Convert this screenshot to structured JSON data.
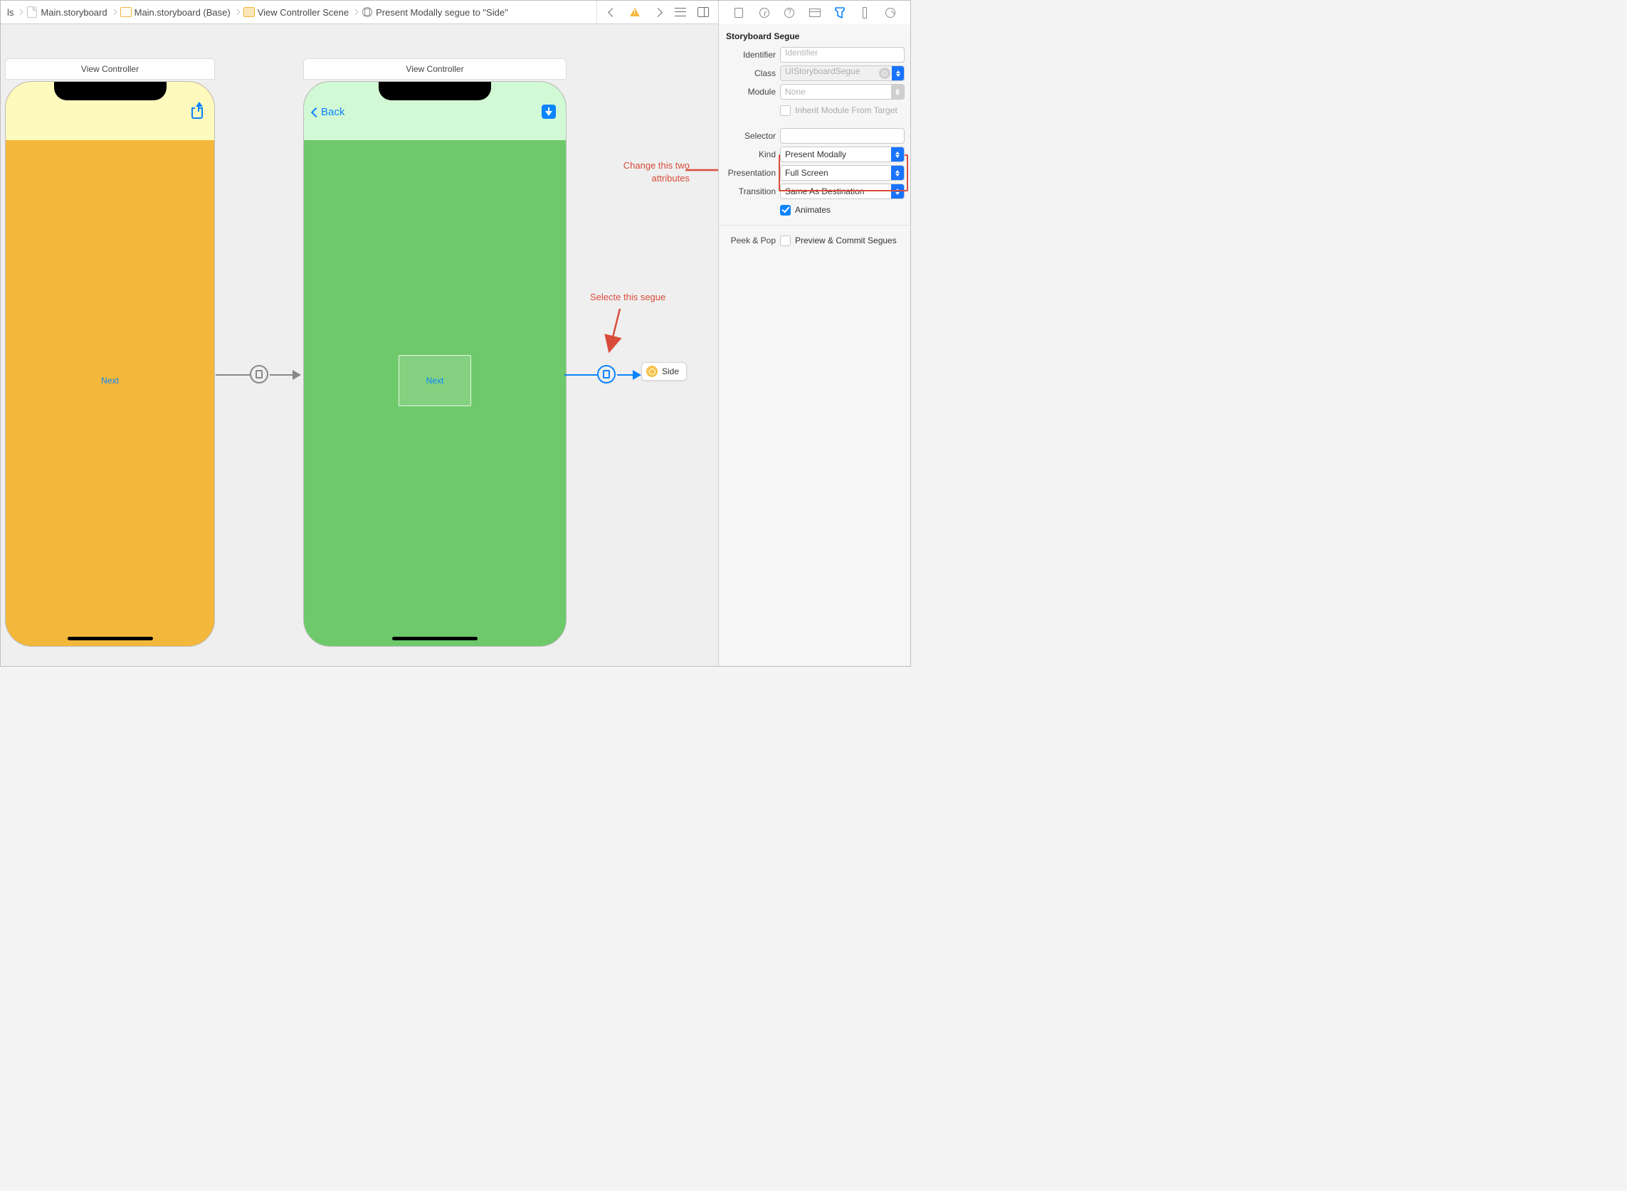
{
  "breadcrumb": {
    "items": [
      {
        "icon": "storyboard-file-icon",
        "label": "Main.storyboard"
      },
      {
        "icon": "storyboard-group-icon",
        "label": "Main.storyboard (Base)"
      },
      {
        "icon": "scene-icon",
        "label": "View Controller Scene"
      },
      {
        "icon": "segue-icon",
        "label": "Present Modally segue to \"Side\""
      }
    ],
    "truncated_prefix": "ls"
  },
  "canvas": {
    "vc1": {
      "title": "View Controller",
      "header_bg": "#fefabe",
      "body_bg": "#f3b73b",
      "nav_right_icon": "share-icon",
      "center_label": "Next"
    },
    "vc2": {
      "title": "View Controller",
      "header_bg": "#d2f9d5",
      "body_bg": "#6ec96b",
      "nav_back_label": "Back",
      "nav_right_icon": "download-icon",
      "center_button_label": "Next"
    },
    "side_ref": {
      "label": "Side"
    }
  },
  "annotations": {
    "change_attrs": "Change this two\nattributes",
    "select_segue": "Selecte this segue"
  },
  "inspector": {
    "section_title": "Storyboard Segue",
    "identifier": {
      "label": "Identifier",
      "placeholder": "Identifier",
      "value": ""
    },
    "klass": {
      "label": "Class",
      "placeholder": "UIStoryboardSegue",
      "value": ""
    },
    "module": {
      "label": "Module",
      "placeholder": "None",
      "value": ""
    },
    "inherit": {
      "label": "Inherit Module From Target",
      "checked": false
    },
    "selector": {
      "label": "Selector",
      "value": ""
    },
    "kind": {
      "label": "Kind",
      "value": "Present Modally"
    },
    "presentation": {
      "label": "Presentation",
      "value": "Full Screen"
    },
    "transition": {
      "label": "Transition",
      "value": "Same As Destination"
    },
    "animates": {
      "label": "Animates",
      "checked": true
    },
    "peekpop": {
      "label": "Peek & Pop",
      "option_label": "Preview & Commit Segues",
      "checked": false
    }
  },
  "inspector_tabs": {
    "active": "attributes"
  }
}
